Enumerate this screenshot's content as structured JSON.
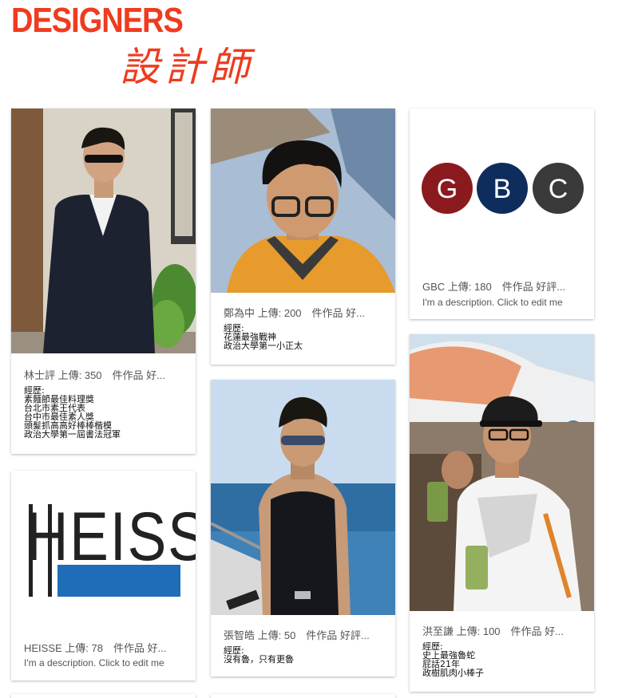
{
  "header": {
    "title_en": "DESIGNERS",
    "title_zh": "設計師"
  },
  "cards": [
    {
      "title": "林士評 上傳: 350　件作品 好...",
      "lines": [
        "經歷:",
        "素麵節最佳料理獎",
        "台北市素王代表",
        "台中市最佳素人獎",
        "頭髮抓高高好棒棒楷模",
        "政治大學第一屆書法冠軍"
      ]
    },
    {
      "title": "鄭為中 上傳: 200　件作品 好...",
      "lines": [
        "經歷:",
        "花蓮最強戰神",
        "政治大學第一小正太"
      ]
    },
    {
      "title": "GBC 上傳: 180　件作品 好評...",
      "description": "I'm a description. Click to edit me",
      "logo_letters": [
        "G",
        "B",
        "C"
      ],
      "logo_colors": [
        "#8b1a1f",
        "#0e2d5c",
        "#3a3a3a"
      ]
    },
    {
      "title": "張智皓 上傳: 50　件作品 好評...",
      "lines": [
        "經歷:",
        "沒有魯，只有更魯"
      ]
    },
    {
      "title": "HEISSE 上傳: 78　件作品 好...",
      "description": "I'm a description. Click to edit me",
      "logo_text": "HEISSE"
    },
    {
      "title": "洪至謙 上傳: 100　件作品 好...",
      "lines": [
        "經歷:",
        "史上最強魯蛇",
        "屁話21年",
        "政樹肌肉小棒子"
      ]
    }
  ]
}
